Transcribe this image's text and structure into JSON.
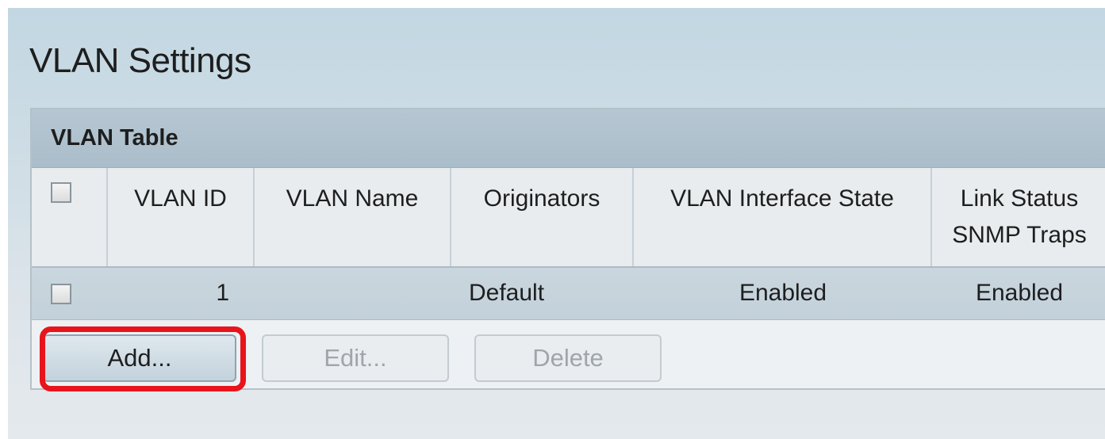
{
  "page": {
    "title": "VLAN Settings"
  },
  "vlan_table": {
    "caption": "VLAN Table",
    "columns": {
      "vlan_id": "VLAN ID",
      "vlan_name": "VLAN Name",
      "originators": "Originators",
      "interface_state": "VLAN Interface State",
      "link_status_line1": "Link Status",
      "link_status_line2": "SNMP Traps"
    },
    "rows": [
      {
        "vlan_id": "1",
        "vlan_name": "",
        "originators": "Default",
        "interface_state": "Enabled",
        "link_status": "Enabled",
        "selected": false
      }
    ],
    "select_all_checked": false
  },
  "buttons": {
    "add": "Add...",
    "edit": "Edit...",
    "delete": "Delete"
  },
  "colors": {
    "highlight": "#e8141c",
    "caption_bg": "#aabdca",
    "disabled_text": "#9ea6ac"
  },
  "icons": {
    "checkbox": "checkbox-unchecked"
  }
}
